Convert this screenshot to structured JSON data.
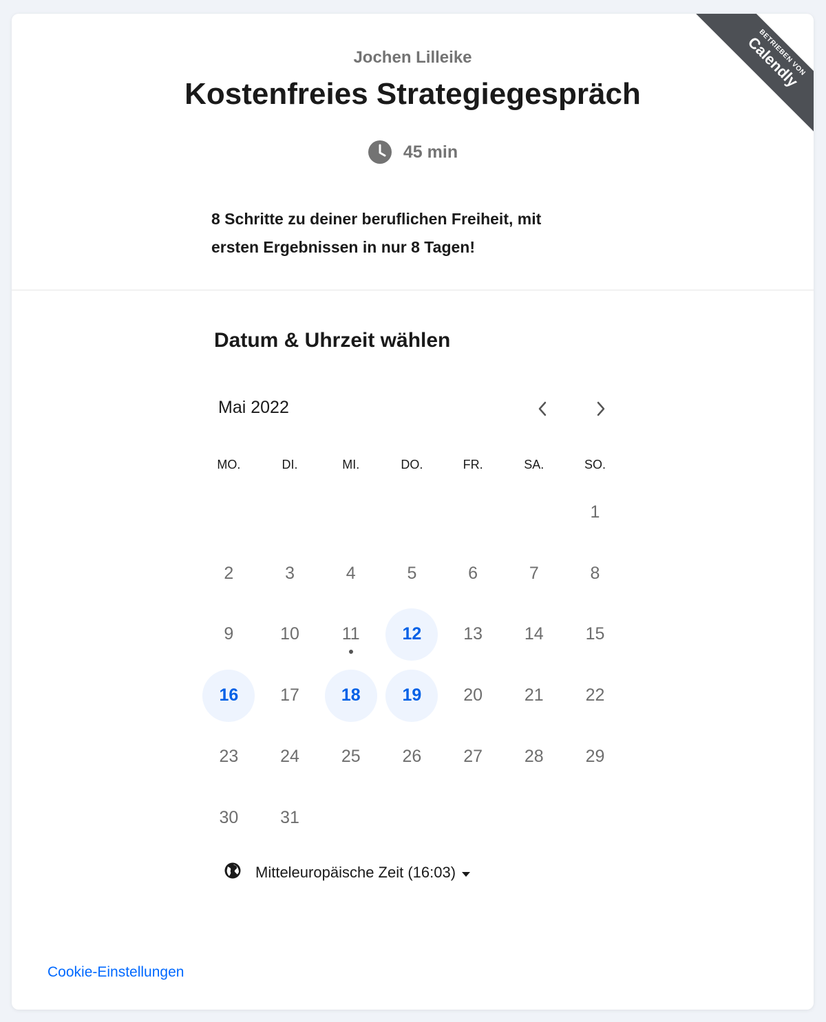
{
  "ribbon": {
    "small": "BETRIEBEN VON",
    "brand": "Calendly"
  },
  "header": {
    "owner": "Jochen Lilleike",
    "title": "Kostenfreies Strategiegespräch",
    "duration": "45 min",
    "description_line1": "8 Schritte zu deiner beruflichen Freiheit, mit",
    "description_line2": "ersten Ergebnissen in nur 8 Tagen!"
  },
  "calendar": {
    "section_title": "Datum & Uhrzeit wählen",
    "month": "Mai 2022",
    "weekdays": [
      "MO.",
      "DI.",
      "MI.",
      "DO.",
      "FR.",
      "SA.",
      "SO."
    ],
    "leading_blanks": 6,
    "days": [
      {
        "n": "1"
      },
      {
        "n": "2"
      },
      {
        "n": "3"
      },
      {
        "n": "4"
      },
      {
        "n": "5"
      },
      {
        "n": "6"
      },
      {
        "n": "7"
      },
      {
        "n": "8"
      },
      {
        "n": "9"
      },
      {
        "n": "10"
      },
      {
        "n": "11",
        "today": true
      },
      {
        "n": "12",
        "available": true
      },
      {
        "n": "13"
      },
      {
        "n": "14"
      },
      {
        "n": "15"
      },
      {
        "n": "16",
        "available": true
      },
      {
        "n": "17"
      },
      {
        "n": "18",
        "available": true
      },
      {
        "n": "19",
        "available": true
      },
      {
        "n": "20"
      },
      {
        "n": "21"
      },
      {
        "n": "22"
      },
      {
        "n": "23"
      },
      {
        "n": "24"
      },
      {
        "n": "25"
      },
      {
        "n": "26"
      },
      {
        "n": "27"
      },
      {
        "n": "28"
      },
      {
        "n": "29"
      },
      {
        "n": "30"
      },
      {
        "n": "31"
      }
    ]
  },
  "timezone": {
    "label": "Mitteleuropäische Zeit (16:03)"
  },
  "footer": {
    "cookie_link": "Cookie-Einstellungen"
  },
  "colors": {
    "accent": "#0060e6",
    "available_bg": "#eef4fe",
    "ribbon_bg": "#4d5055",
    "link": "#0069ff"
  }
}
